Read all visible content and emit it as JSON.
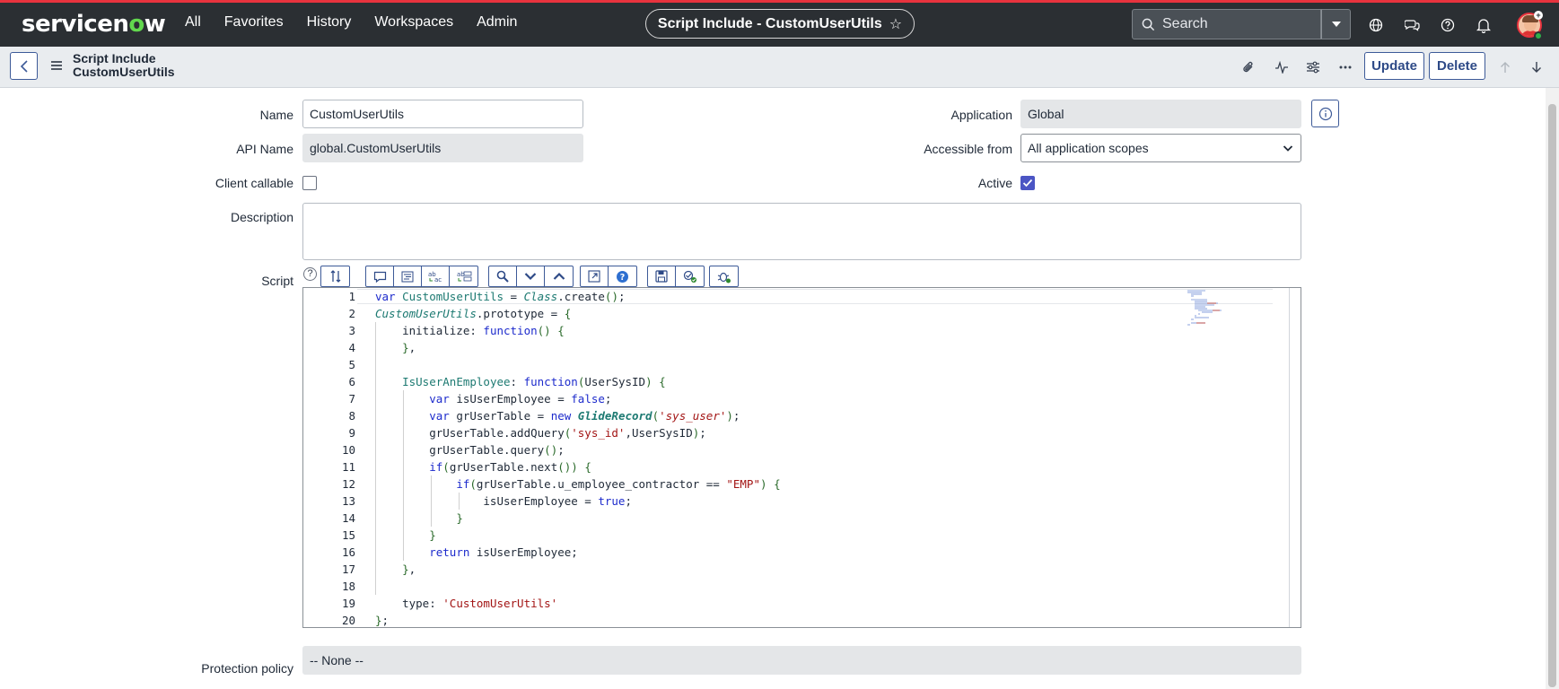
{
  "topnav": {
    "logo_pre": "servicen",
    "logo_o": "o",
    "logo_post": "w",
    "links": [
      "All",
      "Favorites",
      "History",
      "Workspaces",
      "Admin"
    ],
    "title": "Script Include - CustomUserUtils",
    "search_placeholder": "Search"
  },
  "form_header": {
    "title_line1": "Script Include",
    "title_line2": "CustomUserUtils",
    "update_label": "Update",
    "delete_label": "Delete"
  },
  "fields": {
    "name_label": "Name",
    "name_value": "CustomUserUtils",
    "api_name_label": "API Name",
    "api_name_value": "global.CustomUserUtils",
    "client_callable_label": "Client callable",
    "client_callable_checked": false,
    "description_label": "Description",
    "description_value": "",
    "script_label": "Script",
    "application_label": "Application",
    "application_value": "Global",
    "accessible_from_label": "Accessible from",
    "accessible_from_value": "All application scopes",
    "active_label": "Active",
    "active_checked": true,
    "protection_policy_label": "Protection policy",
    "protection_policy_value": "-- None --"
  },
  "script": {
    "line_numbers": [
      "1",
      "2",
      "3",
      "4",
      "5",
      "6",
      "7",
      "8",
      "9",
      "10",
      "11",
      "12",
      "13",
      "14",
      "15",
      "16",
      "17",
      "18",
      "19",
      "20"
    ],
    "lines": [
      "var CustomUserUtils = Class.create();",
      "CustomUserUtils.prototype = {",
      "    initialize: function() {",
      "    },",
      "",
      "    IsUserAnEmployee: function(UserSysID) {",
      "        var isUserEmployee = false;",
      "        var grUserTable = new GlideRecord('sys_user');",
      "        grUserTable.addQuery('sys_id',UserSysID);",
      "        grUserTable.query();",
      "        if(grUserTable.next()) {",
      "            if(grUserTable.u_employee_contractor == \"EMP\") {",
      "                isUserEmployee = true;",
      "            }",
      "        }",
      "        return isUserEmployee;",
      "    },",
      "",
      "    type: 'CustomUserUtils'",
      "};"
    ]
  },
  "colors": {
    "nav_bg": "#2b2f33",
    "accent_red": "#e8333e",
    "button_border": "#3d5a98",
    "checkbox_on": "#4b55c4",
    "keyword": "#1d2bcc",
    "string": "#a31515"
  }
}
